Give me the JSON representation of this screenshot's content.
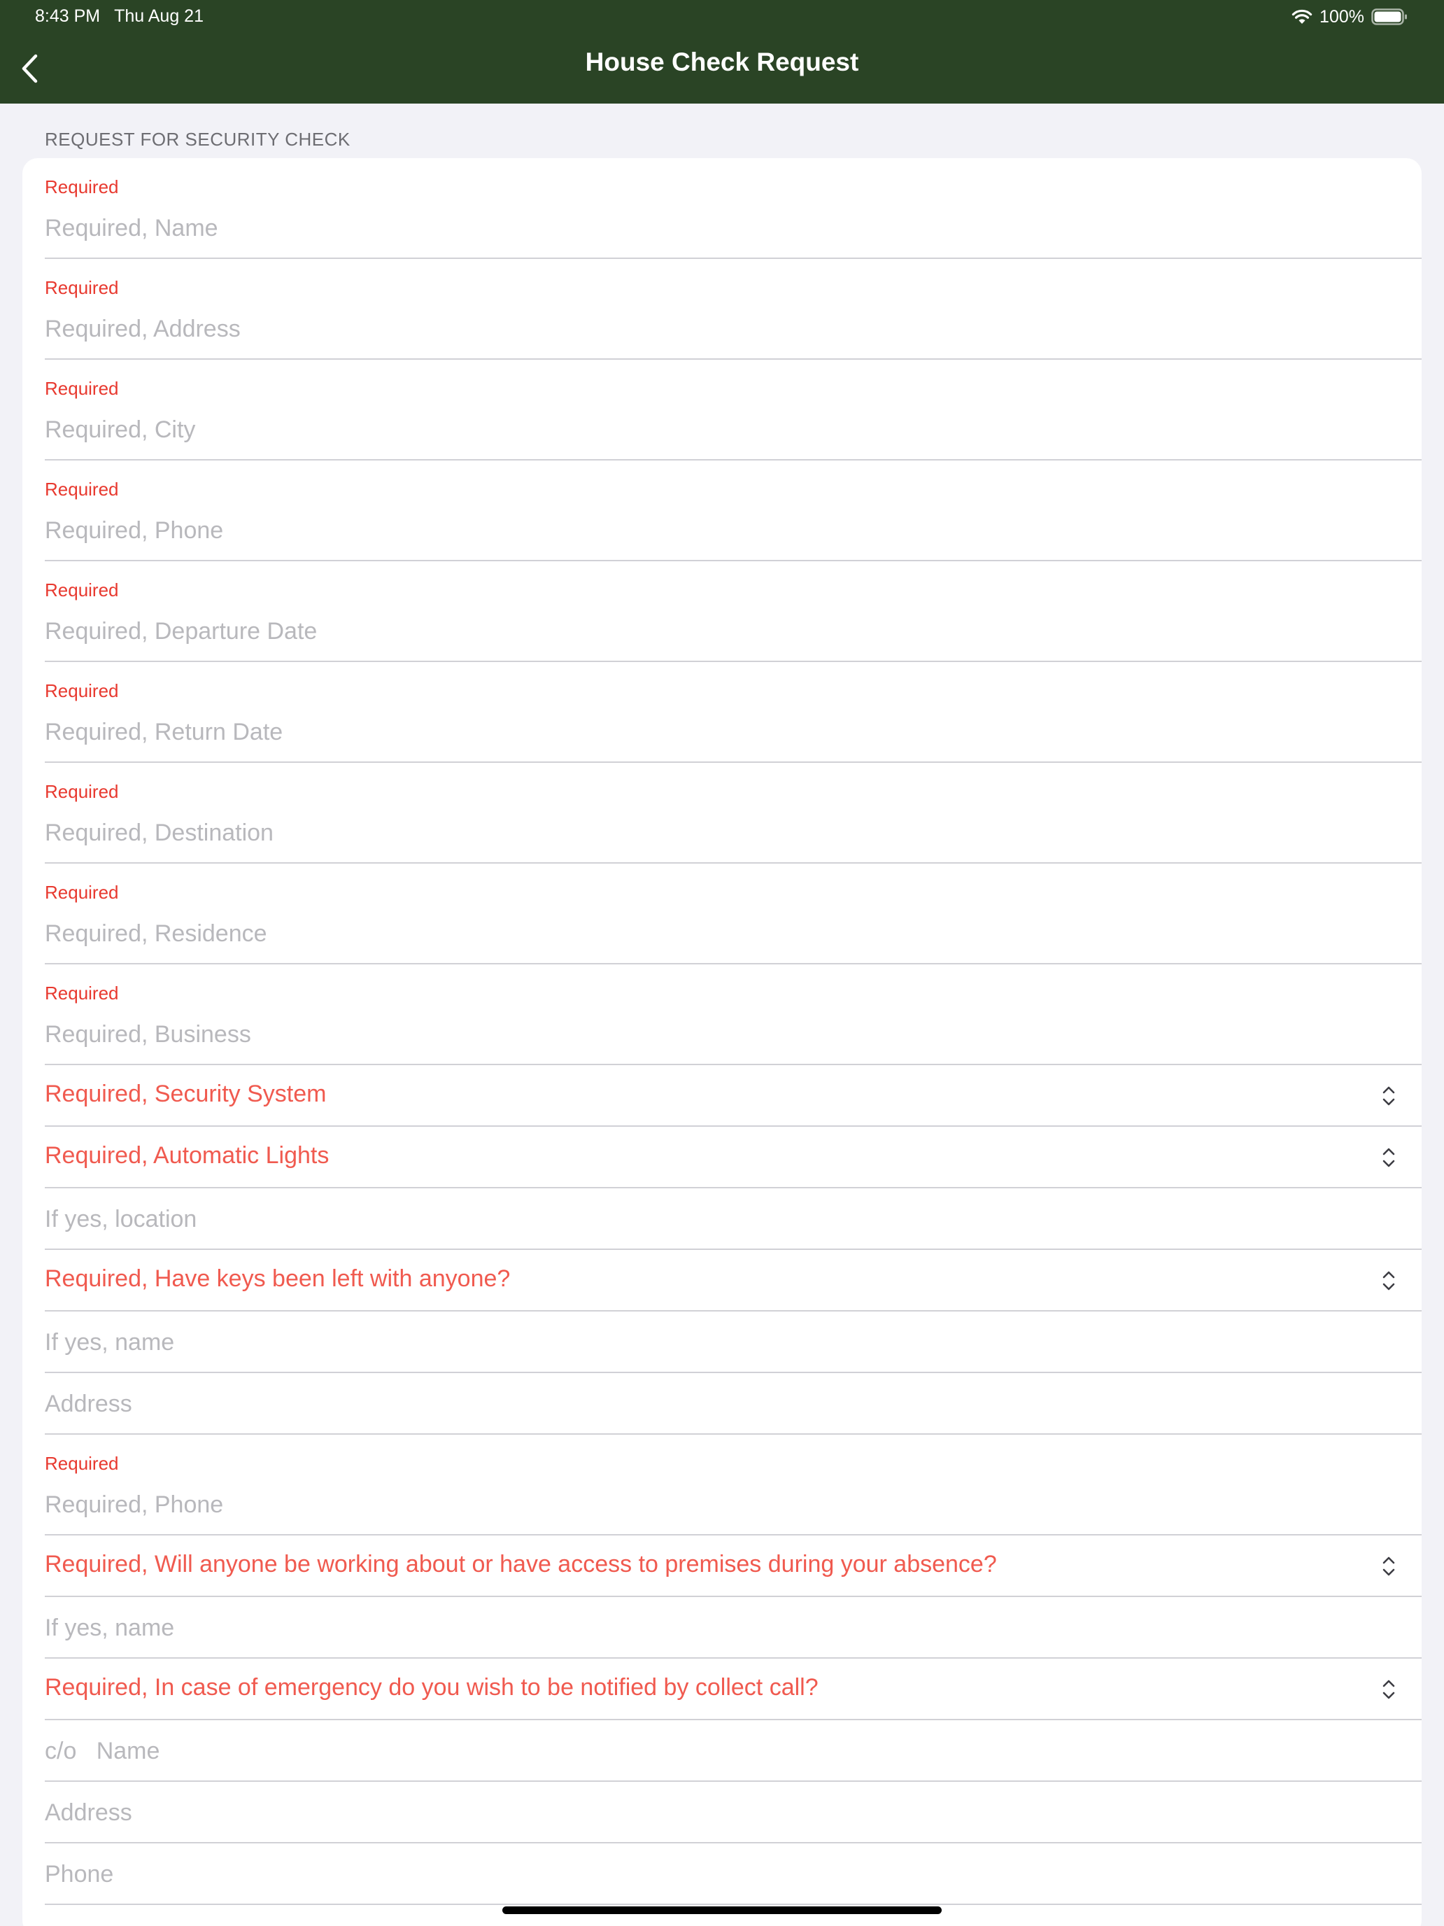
{
  "status_bar": {
    "time": "8:43 PM",
    "date": "Thu Aug 21",
    "battery": "100%"
  },
  "nav": {
    "title": "House Check Request"
  },
  "section_header": "REQUEST FOR SECURITY CHECK",
  "colors": {
    "header_bg": "#2a4425",
    "required": "#e8392f",
    "picker_text": "#f05a4f",
    "placeholder": "#b8b8bc"
  },
  "fields": [
    {
      "type": "required_text",
      "label": "Required",
      "placeholder": "Required, Name"
    },
    {
      "type": "required_text",
      "label": "Required",
      "placeholder": "Required, Address"
    },
    {
      "type": "required_text",
      "label": "Required",
      "placeholder": "Required, City"
    },
    {
      "type": "required_text",
      "label": "Required",
      "placeholder": "Required, Phone"
    },
    {
      "type": "required_text",
      "label": "Required",
      "placeholder": "Required, Departure Date"
    },
    {
      "type": "required_text",
      "label": "Required",
      "placeholder": "Required, Return Date"
    },
    {
      "type": "required_text",
      "label": "Required",
      "placeholder": "Required, Destination"
    },
    {
      "type": "required_text",
      "label": "Required",
      "placeholder": "Required, Residence"
    },
    {
      "type": "required_text",
      "label": "Required",
      "placeholder": "Required, Business"
    },
    {
      "type": "picker",
      "label": "Required, Security System"
    },
    {
      "type": "picker",
      "label": "Required, Automatic Lights"
    },
    {
      "type": "text",
      "placeholder": "If yes, location"
    },
    {
      "type": "picker",
      "label": "Required, Have keys been left with anyone?"
    },
    {
      "type": "text",
      "placeholder": "If yes, name"
    },
    {
      "type": "text",
      "placeholder": "Address"
    },
    {
      "type": "required_text",
      "label": "Required",
      "placeholder": "Required, Phone"
    },
    {
      "type": "picker",
      "label": "Required, Will anyone be working about or have access to premises during your absence?"
    },
    {
      "type": "text",
      "placeholder": "If yes, name"
    },
    {
      "type": "picker",
      "label": "Required, In case of emergency do you wish to be notified by collect call?"
    },
    {
      "type": "text",
      "placeholder": "c/o   Name"
    },
    {
      "type": "text",
      "placeholder": "Address"
    },
    {
      "type": "text",
      "placeholder": "Phone"
    }
  ]
}
